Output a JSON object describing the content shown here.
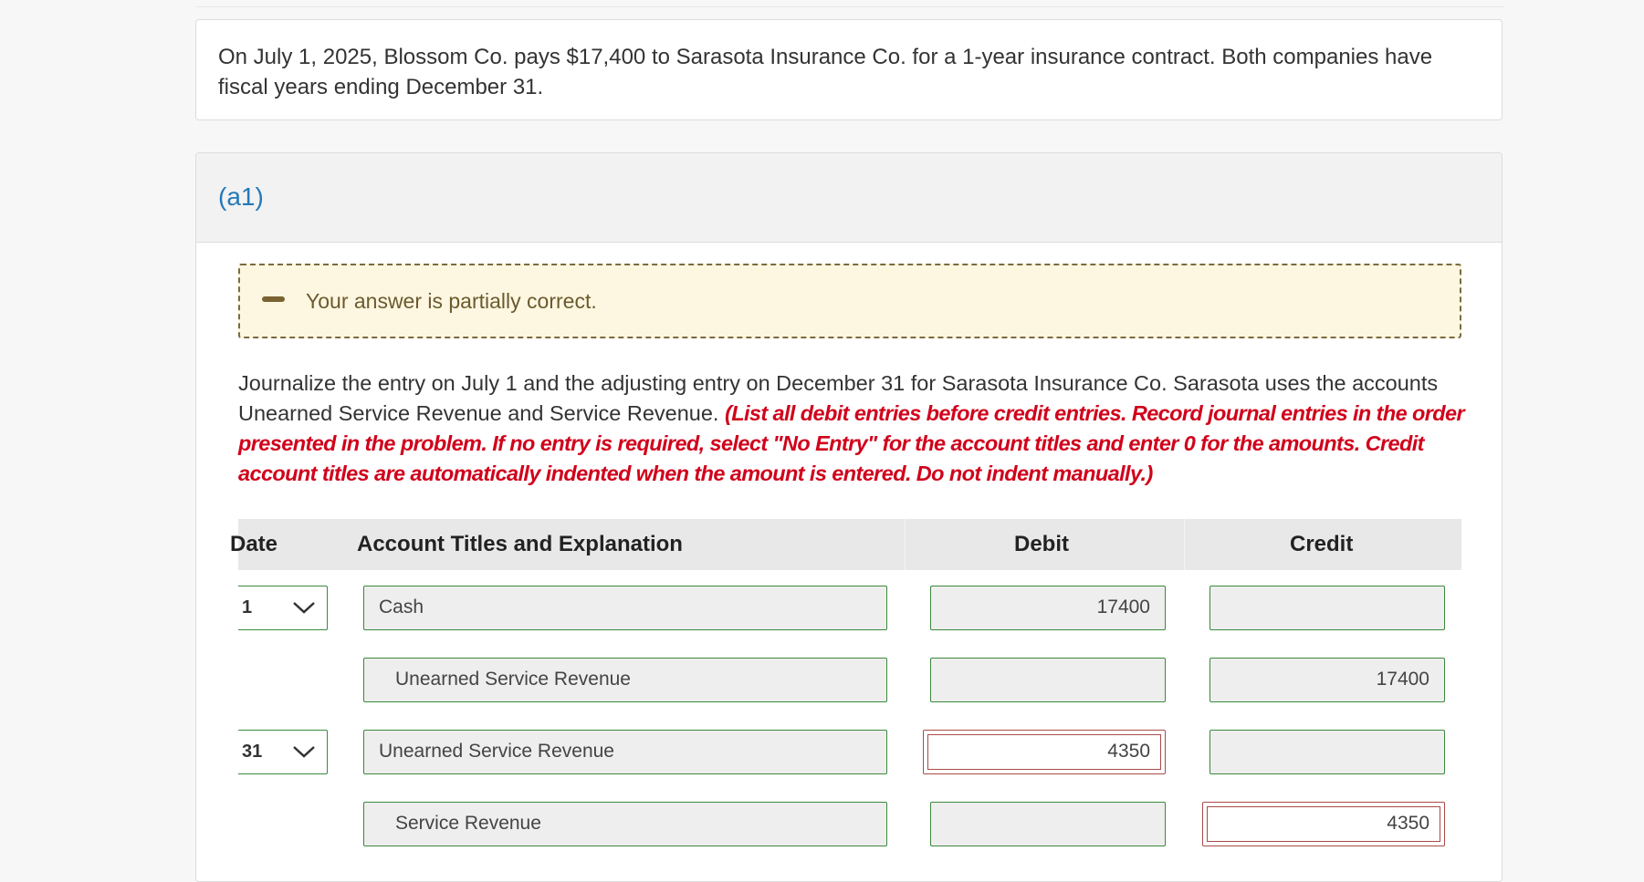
{
  "problem": {
    "text": "On July 1, 2025, Blossom Co. pays $17,400 to Sarasota Insurance Co. for a 1-year insurance contract. Both companies have fiscal years ending December 31."
  },
  "part": {
    "label": "(a1)"
  },
  "feedback": {
    "status": "Your answer is partially correct."
  },
  "instructions": {
    "main": "Journalize the entry on July 1 and the adjusting entry on December 31 for Sarasota Insurance Co. Sarasota uses the accounts Unearned Service Revenue and Service Revenue. ",
    "note": "(List all debit entries before credit entries. Record journal entries in the order presented in the problem. If no entry is required, select \"No Entry\" for the account titles and enter 0 for the amounts. Credit account titles are automatically indented when the amount is entered. Do not indent manually.)"
  },
  "table": {
    "headers": {
      "date": "Date",
      "account": "Account Titles and Explanation",
      "debit": "Debit",
      "credit": "Credit"
    },
    "rows": [
      {
        "date": "1",
        "account": "Cash",
        "debit": "17400",
        "credit": ""
      },
      {
        "date": "",
        "account": "Unearned Service Revenue",
        "debit": "",
        "credit": "17400"
      },
      {
        "date": "31",
        "account": "Unearned Service Revenue",
        "debit": "4350",
        "credit": ""
      },
      {
        "date": "",
        "account": "Service Revenue",
        "debit": "",
        "credit": "4350"
      }
    ]
  },
  "colors": {
    "link_blue": "#2479b8",
    "instruction_red": "#d0021b",
    "correct_green": "#3b8a3b",
    "error_red": "#a94a4a",
    "feedback_bg": "#fdf7e1"
  }
}
